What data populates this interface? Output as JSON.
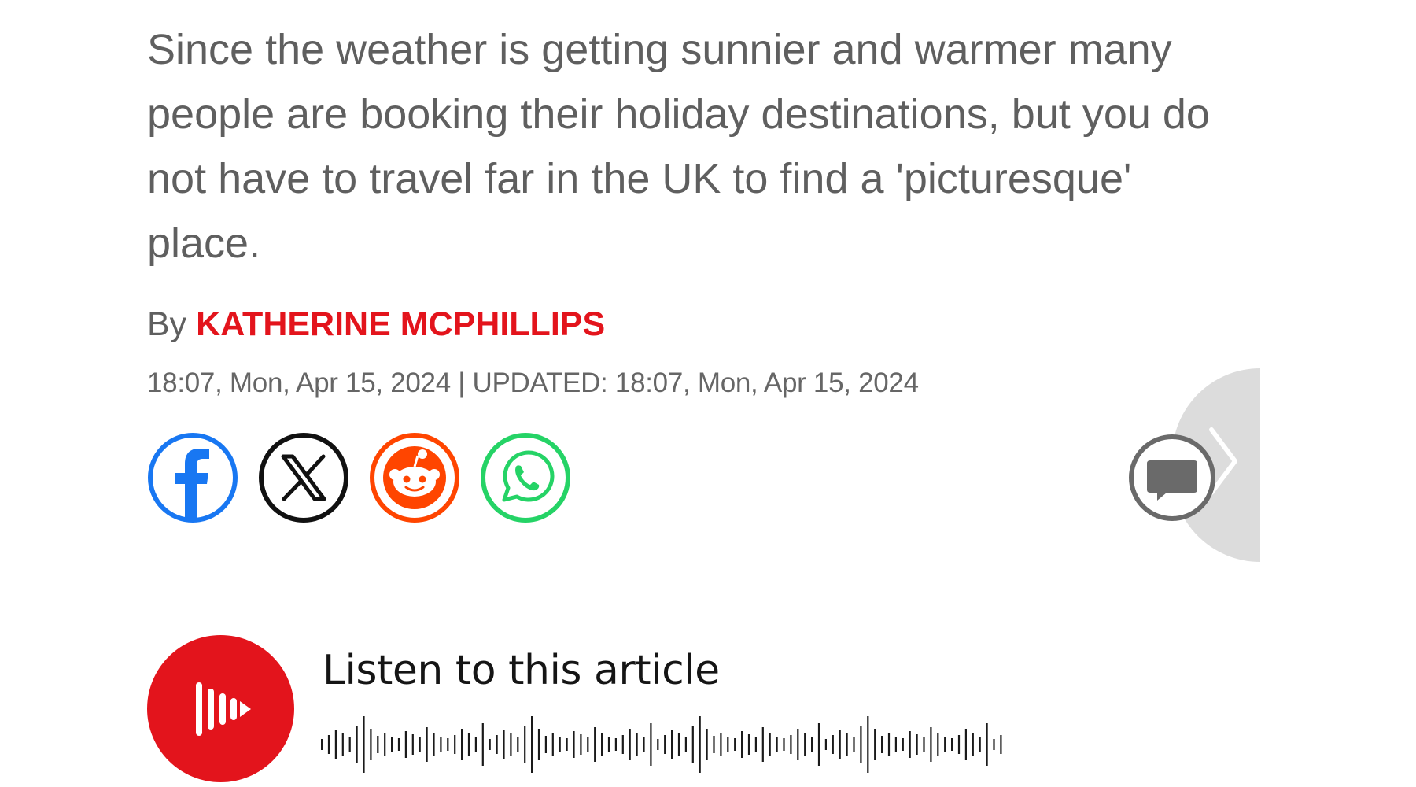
{
  "article": {
    "standfirst": "Since the weather is getting sunnier and warmer many people are booking their holiday destinations, but you do not have to travel far in the UK to find a 'picturesque' place.",
    "byline_prefix": "By",
    "author": "KATHERINE MCPHILLIPS",
    "dateline": "18:07, Mon, Apr 15, 2024 | UPDATED: 18:07, Mon, Apr 15, 2024"
  },
  "share": {
    "buttons": [
      {
        "name": "facebook",
        "icon": "facebook-icon",
        "color": "#1877f2"
      },
      {
        "name": "x",
        "icon": "x-icon",
        "color": "#111111"
      },
      {
        "name": "reddit",
        "icon": "reddit-icon",
        "color": "#ff4500"
      },
      {
        "name": "whatsapp",
        "icon": "whatsapp-icon",
        "color": "#25d366"
      }
    ]
  },
  "comments": {
    "icon": "comment-bubble-icon",
    "color": "#6a6a6a"
  },
  "side_panel": {
    "icon": "chevron-right-icon",
    "color": "#dcdcdc"
  },
  "audio": {
    "title": "Listen to this article",
    "play_icon": "audio-play-icon",
    "waveform_icon": "waveform-icon",
    "accent": "#e3141c"
  }
}
